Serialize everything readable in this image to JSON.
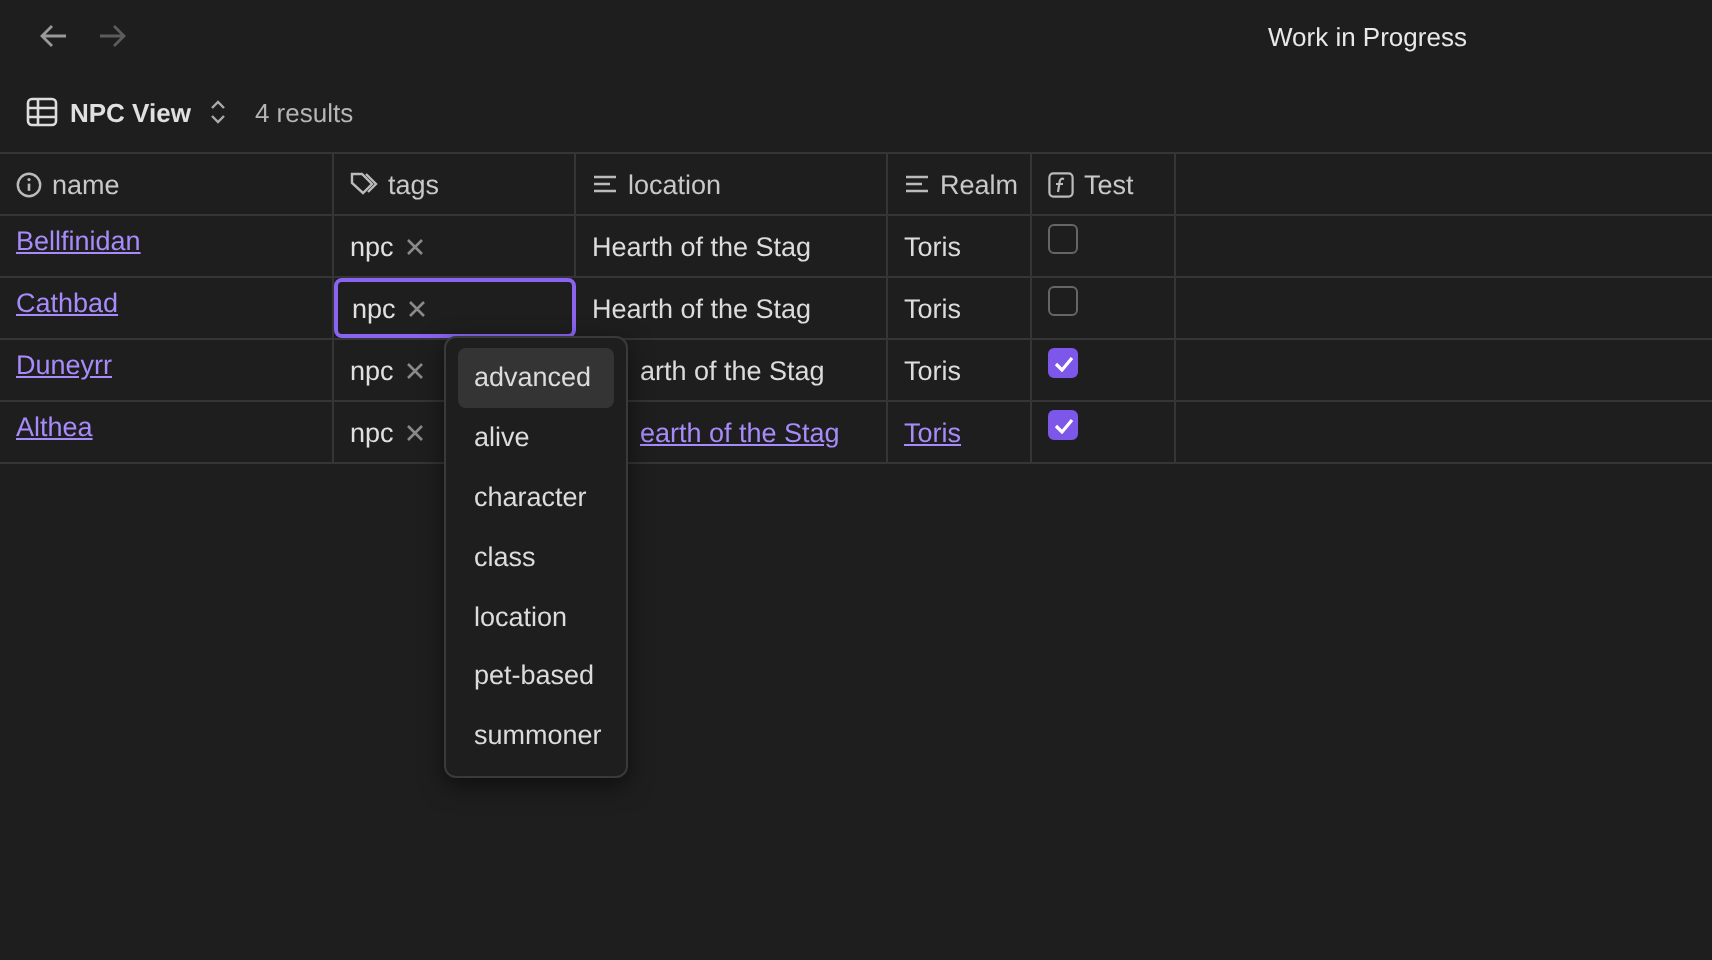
{
  "window": {
    "title": "Work in Progress"
  },
  "view": {
    "name": "NPC View",
    "results": "4 results"
  },
  "table": {
    "columns": [
      {
        "label": "name"
      },
      {
        "label": "tags"
      },
      {
        "label": "location"
      },
      {
        "label": "Realm"
      },
      {
        "label": "Test"
      }
    ],
    "rows": [
      {
        "name": "Bellfinidan",
        "tag": "npc",
        "editing": false,
        "location": "Hearth of the Stag",
        "location_link": false,
        "realm": "Toris",
        "realm_link": false,
        "test": false
      },
      {
        "name": "Cathbad",
        "tag": "npc",
        "editing": true,
        "location": "Hearth of the Stag",
        "location_link": false,
        "realm": "Toris",
        "realm_link": false,
        "test": false
      },
      {
        "name": "Duneyrr",
        "tag": "npc",
        "editing": false,
        "location": "arth of the Stag",
        "location_link": false,
        "realm": "Toris",
        "realm_link": false,
        "test": true
      },
      {
        "name": "Althea",
        "tag": "npc",
        "editing": false,
        "location": "earth of the Stag",
        "location_link": true,
        "realm": "Toris",
        "realm_link": true,
        "test": true
      }
    ]
  },
  "tag_menu": {
    "items": [
      {
        "label": "advanced",
        "selected": true
      },
      {
        "label": "alive",
        "selected": false
      },
      {
        "label": "character",
        "selected": false
      },
      {
        "label": "class",
        "selected": false
      },
      {
        "label": "location",
        "selected": false
      },
      {
        "label": "pet-based",
        "selected": false
      },
      {
        "label": "summoner",
        "selected": false
      }
    ]
  }
}
